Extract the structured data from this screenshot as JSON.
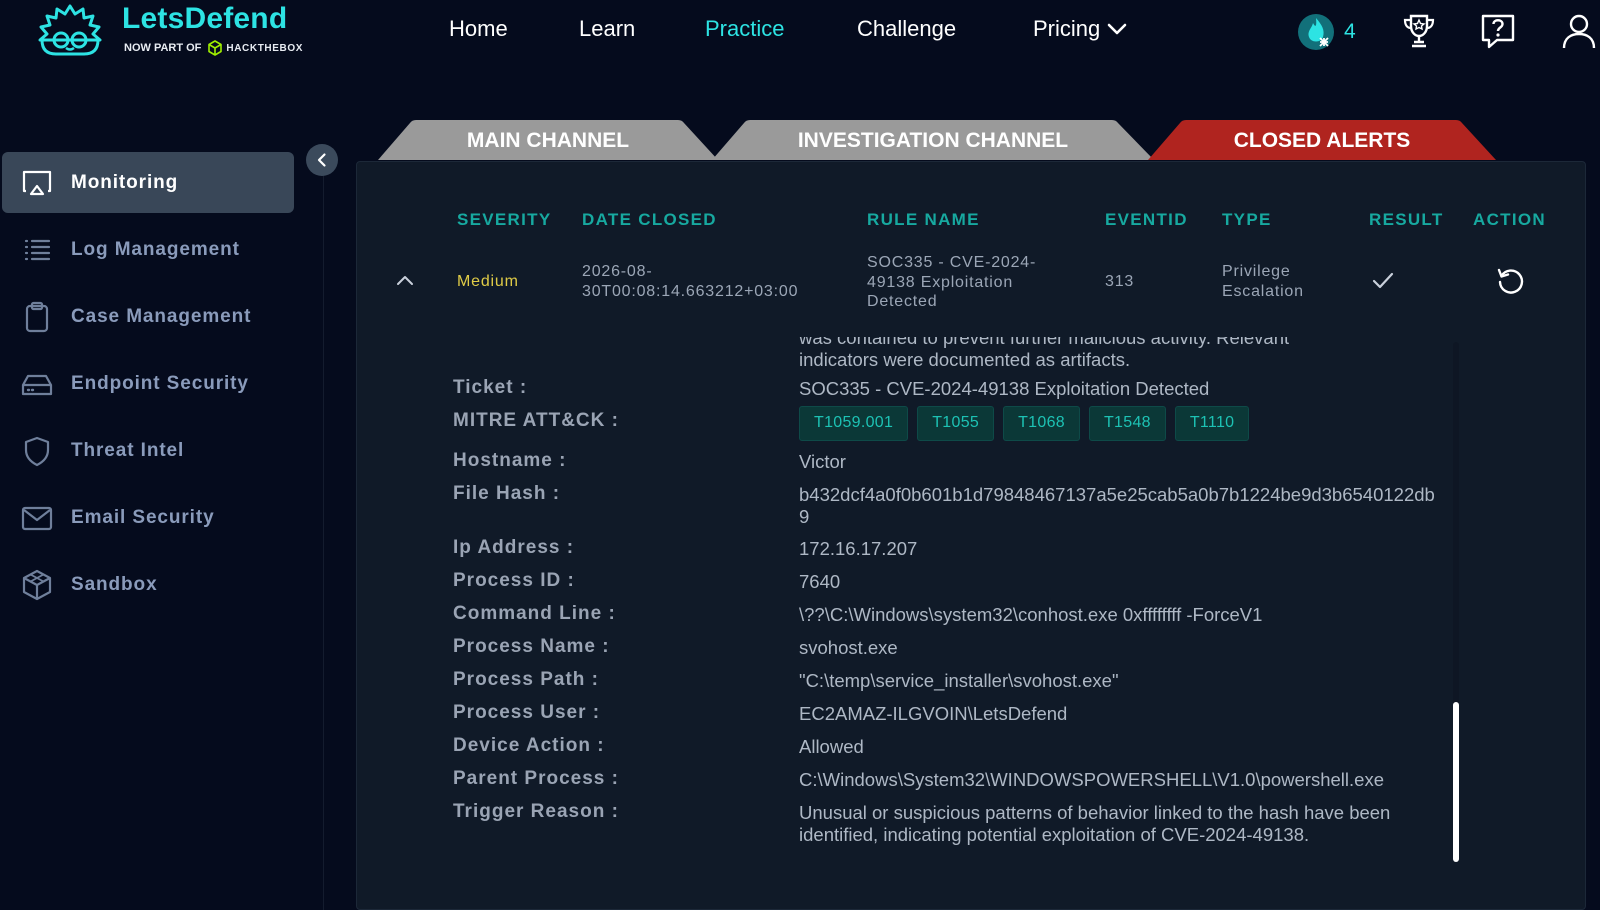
{
  "brand": {
    "name": "LetsDefend",
    "tagline": "NOW PART OF",
    "partner": "HACKTHEBOX",
    "accent": "#2de3e3"
  },
  "nav": {
    "items": [
      "Home",
      "Learn",
      "Practice",
      "Challenge",
      "Pricing"
    ],
    "active": "Practice",
    "streak": "4"
  },
  "sidebar": {
    "items": [
      {
        "label": "Monitoring",
        "icon": "monitor-icon"
      },
      {
        "label": "Log Management",
        "icon": "list-icon"
      },
      {
        "label": "Case Management",
        "icon": "clipboard-icon"
      },
      {
        "label": "Endpoint Security",
        "icon": "drive-icon"
      },
      {
        "label": "Threat Intel",
        "icon": "shield-icon"
      },
      {
        "label": "Email Security",
        "icon": "mail-icon"
      },
      {
        "label": "Sandbox",
        "icon": "cube-icon"
      }
    ],
    "active": "Monitoring"
  },
  "tabs": [
    {
      "label": "MAIN CHANNEL",
      "color": "#9a9a9a"
    },
    {
      "label": "INVESTIGATION CHANNEL",
      "color": "#9a9a9a"
    },
    {
      "label": "CLOSED ALERTS",
      "color": "#b0241f"
    }
  ],
  "table": {
    "headers": [
      "SEVERITY",
      "DATE CLOSED",
      "RULE NAME",
      "EVENTID",
      "TYPE",
      "RESULT",
      "ACTION"
    ],
    "row": {
      "severity": "Medium",
      "date_closed_1": "2026-08-",
      "date_closed_2": "30T00:08:14.663212+03:00",
      "rule_name_1": "SOC335 - CVE-2024-",
      "rule_name_2": "49138 Exploitation",
      "rule_name_3": "Detected",
      "event_id": "313",
      "type_1": "Privilege",
      "type_2": "Escalation"
    }
  },
  "details": {
    "clipped_text_1": "was contained to prevent further malicious activity. Relevant",
    "clipped_text_2": "indicators were documented as artifacts.",
    "labels": {
      "ticket": "Ticket :",
      "mitre": "MITRE ATT&CK :",
      "hostname": "Hostname :",
      "file_hash": "File Hash :",
      "ip": "Ip Address :",
      "pid": "Process ID :",
      "cmd": "Command Line :",
      "pname": "Process Name :",
      "ppath": "Process Path :",
      "puser": "Process User :",
      "action": "Device Action :",
      "parent": "Parent Process :",
      "trigger": "Trigger Reason :"
    },
    "values": {
      "ticket": "SOC335 - CVE-2024-49138 Exploitation Detected",
      "mitre": [
        "T1059.001",
        "T1055",
        "T1068",
        "T1548",
        "T1110"
      ],
      "hostname": "Victor",
      "file_hash": "b432dcf4a0f0b601b1d79848467137a5e25cab5a0b7b1224be9d3b6540122db9",
      "ip": "172.16.17.207",
      "pid": "7640",
      "cmd": "\\??\\C:\\Windows\\system32\\conhost.exe 0xffffffff -ForceV1",
      "pname": "svohost.exe",
      "ppath": "\"C:\\temp\\service_installer\\svohost.exe\"",
      "puser": "EC2AMAZ-ILGVOIN\\LetsDefend",
      "action": "Allowed",
      "parent": "C:\\Windows\\System32\\WINDOWSPOWERSHELL\\V1.0\\powershell.exe",
      "trigger": "Unusual or suspicious patterns of behavior linked to the hash have been identified, indicating potential exploitation of CVE-2024-49138."
    }
  }
}
